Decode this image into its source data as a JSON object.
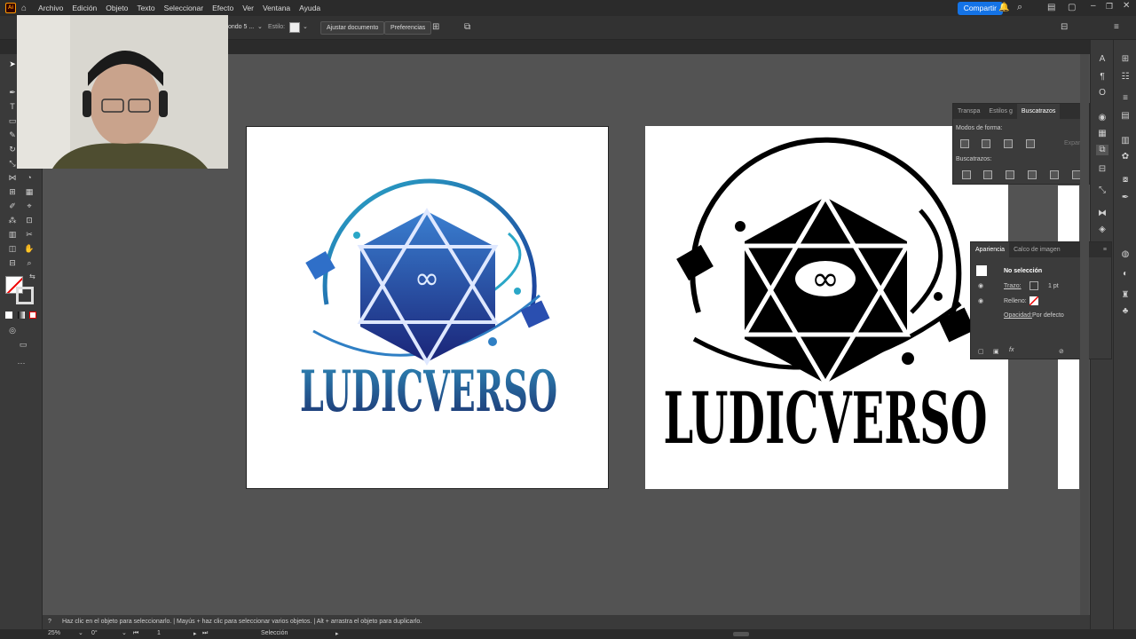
{
  "app": {
    "logo": "Ai",
    "menus": [
      "Archivo",
      "Edición",
      "Objeto",
      "Texto",
      "Seleccionar",
      "Efecto",
      "Ver",
      "Ventana",
      "Ayuda"
    ],
    "share_label": "Compartir"
  },
  "controlbar": {
    "fill_partial": "ondo 5 ...",
    "style_label": "Estilo:",
    "adjust_document": "Ajustar documento",
    "preferences": "Preferencias"
  },
  "pathfinder_panel": {
    "tabs": [
      "Transpa",
      "Estilos g",
      "Buscatrazos"
    ],
    "shape_modes_label": "Modos de forma:",
    "expand_label": "Expandir",
    "pathfinders_label": "Buscatrazos:"
  },
  "appearance_panel": {
    "tabs": [
      "Apariencia",
      "Calco de imagen"
    ],
    "selection_label": "No selección",
    "stroke_label": "Trazo:",
    "stroke_value": "1 pt",
    "fill_label": "Relleno:",
    "opacity_label": "Opacidad:",
    "opacity_value": "Por defecto"
  },
  "artboards": {
    "left_logo_text": "LUDICVERSO",
    "right_logo_text": "LUDICVERSO",
    "infinity_symbol": "∞"
  },
  "hint": "Haz clic en el objeto para seleccionarlo. | Mayús + haz clic para seleccionar varios objetos. | Alt + arrastra el objeto para duplicarlo.",
  "status": {
    "zoom": "25%",
    "rotation": "0°",
    "artboard_index": "1",
    "tool_name": "Selección"
  },
  "colors": {
    "accent": "#1473e6",
    "logo_blue_dark": "#1e2f8a",
    "logo_blue_light": "#29a3c8",
    "canvas_bg": "#535353"
  }
}
